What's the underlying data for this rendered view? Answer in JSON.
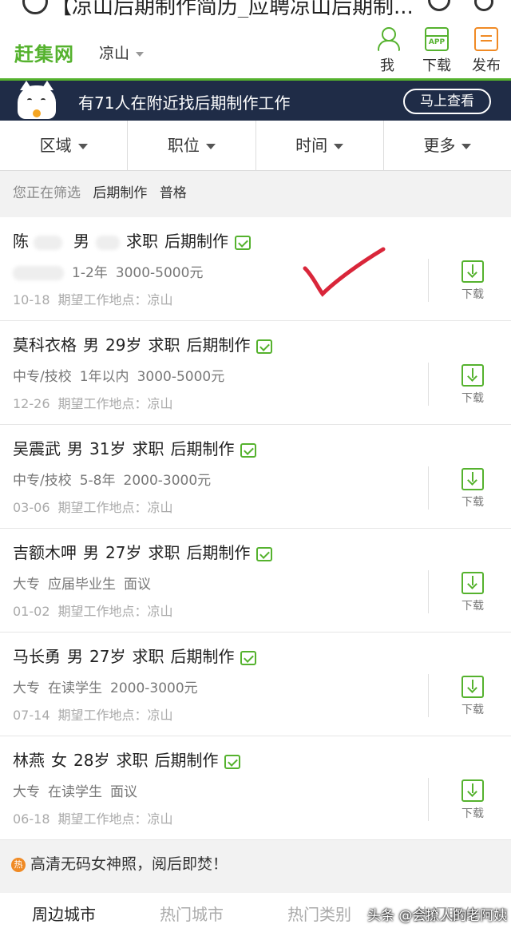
{
  "browser": {
    "title": "【凉山后期制作简历_应聘凉山后期制..."
  },
  "header": {
    "logo": "赶集网",
    "city": "凉山",
    "buttons": [
      {
        "label": "我",
        "icon": "user-icon"
      },
      {
        "label": "下载",
        "icon": "app-download-icon"
      },
      {
        "label": "发布",
        "icon": "post-edit-icon"
      }
    ]
  },
  "banner": {
    "text": "有71人在附近找后期制作工作",
    "button": "马上查看"
  },
  "filters": [
    "区域",
    "职位",
    "时间",
    "更多"
  ],
  "screening": {
    "label": "您正在筛选",
    "tags": [
      "后期制作",
      "普格"
    ]
  },
  "resumes": [
    {
      "name": "陈",
      "gender": "男",
      "age": "",
      "seek": "求职",
      "job": "后期制作",
      "edu": "",
      "exp": "1-2年",
      "salary": "3000-5000元",
      "date": "10-18",
      "loc_label": "期望工作地点：",
      "loc": "凉山",
      "download": "下载"
    },
    {
      "name": "莫科衣格",
      "gender": "男",
      "age": "29岁",
      "seek": "求职",
      "job": "后期制作",
      "edu": "中专/技校",
      "exp": "1年以内",
      "salary": "3000-5000元",
      "date": "12-26",
      "loc_label": "期望工作地点：",
      "loc": "凉山",
      "download": "下载"
    },
    {
      "name": "吴震武",
      "gender": "男",
      "age": "31岁",
      "seek": "求职",
      "job": "后期制作",
      "edu": "中专/技校",
      "exp": "5-8年",
      "salary": "2000-3000元",
      "date": "03-06",
      "loc_label": "期望工作地点：",
      "loc": "凉山",
      "download": "下载"
    },
    {
      "name": "吉额木呷",
      "gender": "男",
      "age": "27岁",
      "seek": "求职",
      "job": "后期制作",
      "edu": "大专",
      "exp": "应届毕业生",
      "salary": "面议",
      "date": "01-02",
      "loc_label": "期望工作地点：",
      "loc": "凉山",
      "download": "下载"
    },
    {
      "name": "马长勇",
      "gender": "男",
      "age": "27岁",
      "seek": "求职",
      "job": "后期制作",
      "edu": "大专",
      "exp": "在读学生",
      "salary": "2000-3000元",
      "date": "07-14",
      "loc_label": "期望工作地点：",
      "loc": "凉山",
      "download": "下载"
    },
    {
      "name": "林燕",
      "gender": "女",
      "age": "28岁",
      "seek": "求职",
      "job": "后期制作",
      "edu": "大专",
      "exp": "在读学生",
      "salary": "面议",
      "date": "06-18",
      "loc_label": "期望工作地点：",
      "loc": "凉山",
      "download": "下载"
    }
  ],
  "promo": {
    "badge": "热",
    "text": "高清无码女神照，阅后即焚！"
  },
  "bottom_tabs": [
    "周边城市",
    "热门城市",
    "热门类别",
    "热门职位"
  ],
  "watermark": "头条 @会撩人的老阿姨",
  "colors": {
    "brand": "#55b22e",
    "banner_bg": "#1f2c47",
    "annotation": "#d9263a"
  }
}
